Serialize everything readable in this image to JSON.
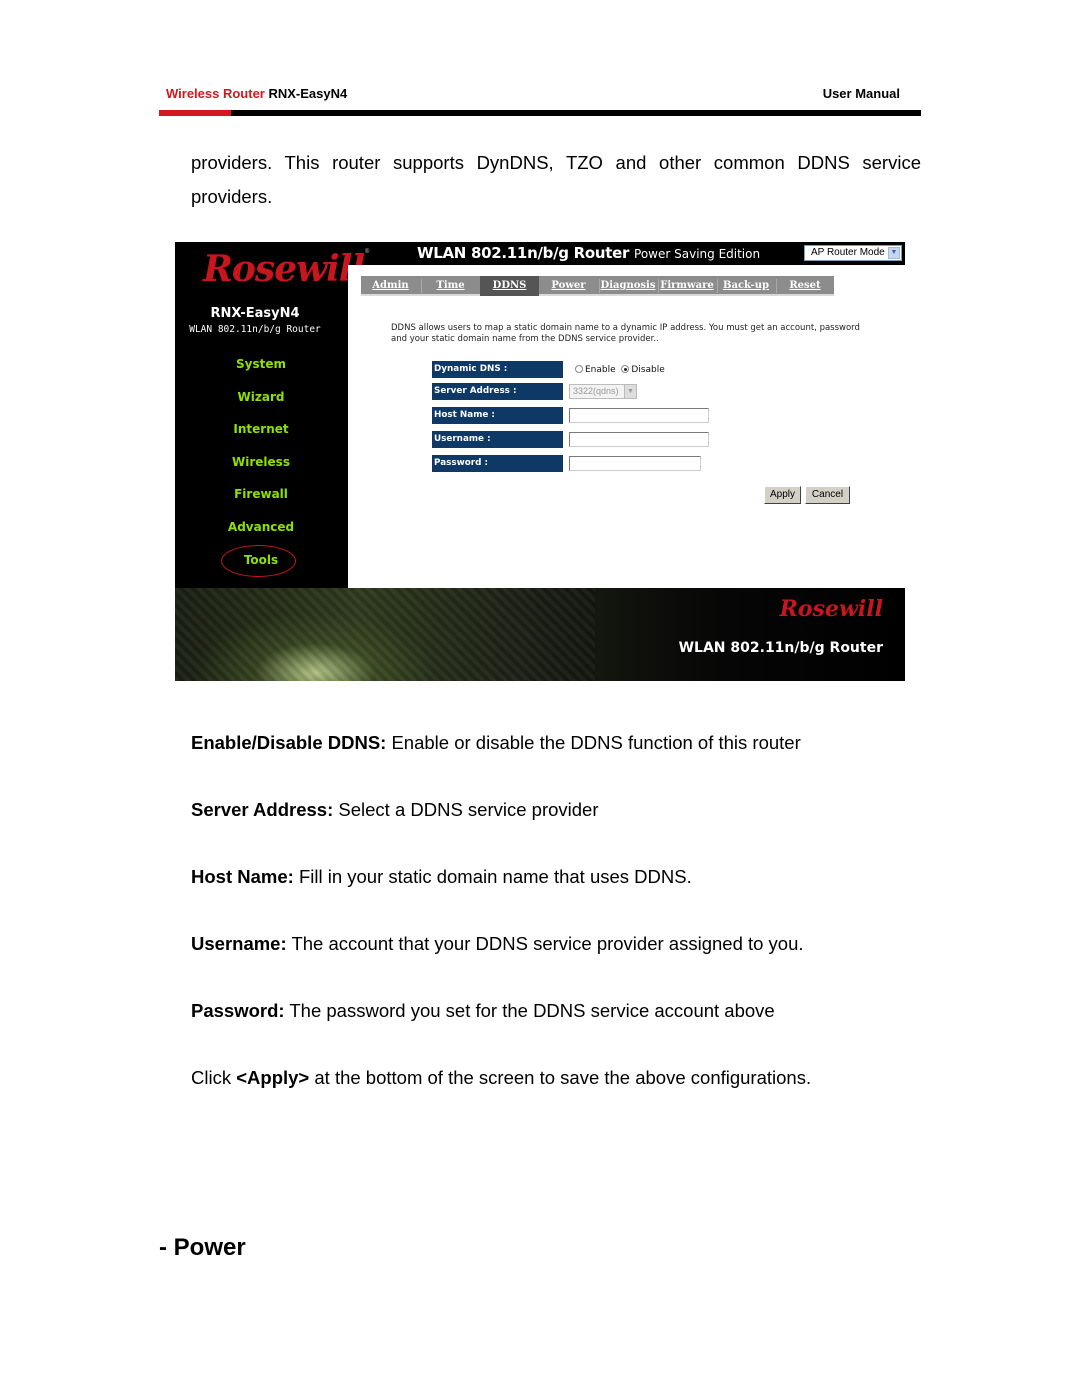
{
  "header": {
    "product_red": "Wireless Router",
    "product_model": "RNX-EasyN4",
    "manual_label": "User Manual",
    "accent_color": "#d4161f"
  },
  "intro_text": "providers. This router supports DynDNS, TZO and other common DDNS service providers.",
  "screenshot": {
    "title_main": "WLAN 802.11n/b/g Router",
    "title_sub": "Power Saving Edition",
    "mode_select": {
      "value": "AP Router Mode",
      "icon": "chevron-down-icon"
    },
    "logo_text": "Rosewill",
    "model": "RNX-EasyN4",
    "model_sub": "WLAN 802.11n/b/g Router",
    "menu": [
      {
        "label": "System"
      },
      {
        "label": "Wizard"
      },
      {
        "label": "Internet"
      },
      {
        "label": "Wireless"
      },
      {
        "label": "Firewall"
      },
      {
        "label": "Advanced"
      },
      {
        "label": "Tools",
        "highlighted": true
      }
    ],
    "tabs": [
      {
        "label": "Admin"
      },
      {
        "label": "Time"
      },
      {
        "label": "DDNS",
        "active": true
      },
      {
        "label": "Power"
      },
      {
        "label": "Diagnosis"
      },
      {
        "label": "Firmware"
      },
      {
        "label": "Back-up"
      },
      {
        "label": "Reset"
      }
    ],
    "description": "DDNS allows users to map a static domain name to a dynamic IP address. You must get an account, password and your static domain name from the DDNS service provider..",
    "form": {
      "dynamic_dns_label": "Dynamic DNS :",
      "enable_label": "Enable",
      "disable_label": "Disable",
      "selected": "Disable",
      "server_address_label": "Server Address :",
      "server_address_value": "3322(qdns)",
      "host_name_label": "Host Name :",
      "host_name_value": "",
      "username_label": "Username :",
      "username_value": "",
      "password_label": "Password :",
      "password_value": ""
    },
    "apply_label": "Apply",
    "cancel_label": "Cancel",
    "banner_logo": "Rosewill",
    "banner_text": "WLAN 802.11n/b/g Router",
    "colors": {
      "menu_green": "#8fe000",
      "label_navy": "#0e3866",
      "logo_red": "#c8161e"
    }
  },
  "items": [
    {
      "term": "Enable/Disable DDNS:",
      "desc": " Enable or disable the DDNS function of this router"
    },
    {
      "term": "Server Address:",
      "desc": " Select a DDNS service provider"
    },
    {
      "term": "Host Name:",
      "desc": " Fill in your static domain name that uses DDNS."
    },
    {
      "term": "Username:",
      "desc": " The account that your DDNS service provider assigned to you."
    },
    {
      "term": "Password:",
      "desc": " The password you set for the DDNS service account above"
    }
  ],
  "click_line": {
    "pre": "Click ",
    "bold": "<Apply>",
    "post": " at the bottom of the screen to save the above configurations."
  },
  "section_title": "- Power"
}
